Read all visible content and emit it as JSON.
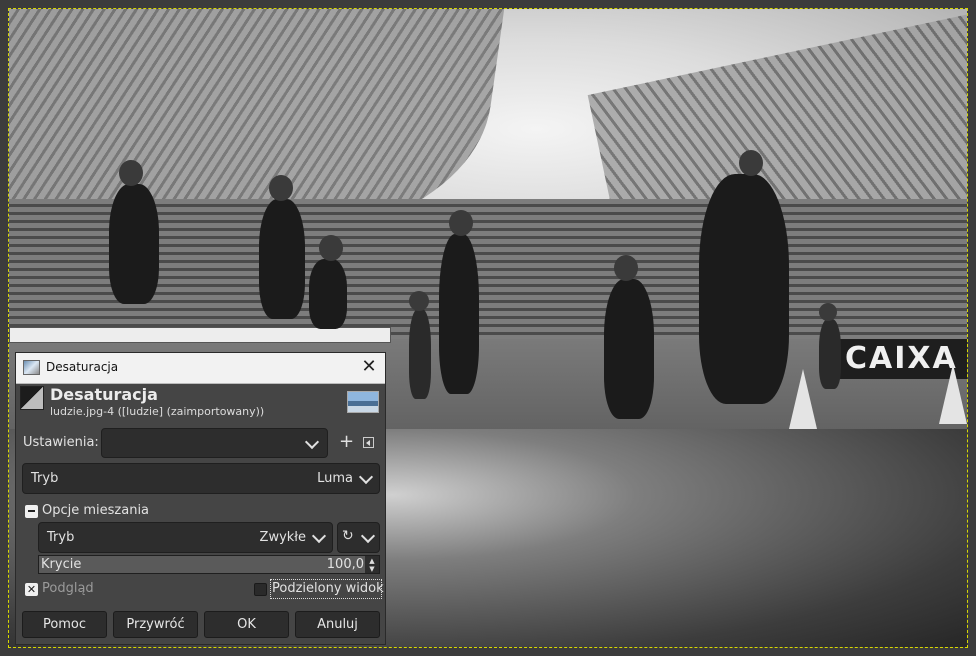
{
  "dialog": {
    "window_title": "Desaturacja",
    "heading": "Desaturacja",
    "subtitle": "ludzie.jpg-4 ([ludzie] (zaimportowany))",
    "presets_label": "Ustawienia:",
    "presets_value": "",
    "mode_label": "Tryb",
    "mode_value": "Luma",
    "blend_section_label": "Opcje mieszania",
    "blend_mode_label": "Tryb",
    "blend_mode_value": "Zwykłe",
    "opacity_label": "Krycie",
    "opacity_value": "100,0",
    "opacity_fraction": 1.0,
    "preview_label": "Podgląd",
    "preview_checked": true,
    "split_view_label": "Podzielony widok",
    "split_view_checked": false,
    "buttons": {
      "help": "Pomoc",
      "reset": "Przywróć",
      "ok": "OK",
      "cancel": "Anuluj"
    }
  },
  "canvas": {
    "banner_text": "CAIXA"
  },
  "icons": {
    "window_icon": "image-icon",
    "filter_icon": "desaturate-icon",
    "close": "close-icon",
    "add_preset": "plus-icon",
    "presets_menu": "menu-icon",
    "reset_blend": "reset-icon"
  }
}
